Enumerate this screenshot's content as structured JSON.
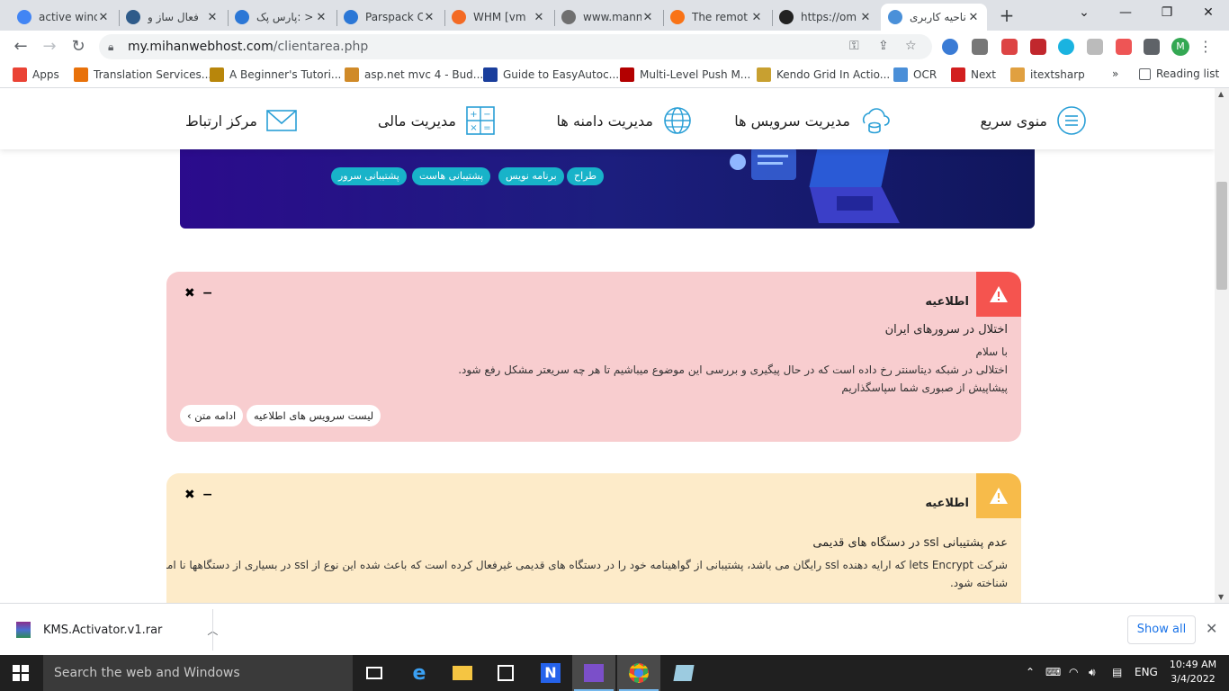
{
  "browser": {
    "tabs": [
      {
        "title": "active winc",
        "color": "#4285f4",
        "icon": "google-icon"
      },
      {
        "title": "فعال ساز و",
        "color": "#2f5b8a",
        "icon": "s-icon"
      },
      {
        "title": "پارس پک: >",
        "color": "#2b77d6",
        "icon": "parspack-icon"
      },
      {
        "title": "Parspack C",
        "color": "#2b77d6",
        "icon": "parspack-icon"
      },
      {
        "title": "WHM [vm",
        "color": "#f36a24",
        "icon": "cpanel-icon"
      },
      {
        "title": "www.mann",
        "color": "#6f6f6f",
        "icon": "globe-icon"
      },
      {
        "title": "The remot",
        "color": "#f97316",
        "icon": "mi-icon"
      },
      {
        "title": "https://om",
        "color": "#222222",
        "icon": "om-icon"
      },
      {
        "title": "ناحیه کاربری",
        "color": "#4a90d9",
        "icon": "site-icon"
      }
    ],
    "url_domain": "my.mihanwebhost.com",
    "url_path": "/clientarea.php",
    "profile_initial": "M",
    "bookmarks": [
      {
        "label": "Apps",
        "color": "#ea4335"
      },
      {
        "label": "Translation Services...",
        "color": "#e8710a"
      },
      {
        "label": "A Beginner's Tutori...",
        "color": "#b8860b"
      },
      {
        "label": "asp.net mvc 4 - Bud...",
        "color": "#d08a28"
      },
      {
        "label": "Guide to EasyAutoc...",
        "color": "#1a3e9c"
      },
      {
        "label": "Multi-Level Push M...",
        "color": "#b30000"
      },
      {
        "label": "Kendo Grid In Actio...",
        "color": "#c8a030"
      },
      {
        "label": "OCR",
        "color": "#4a8fd8"
      },
      {
        "label": "Next",
        "color": "#d21f1f"
      },
      {
        "label": "itextsharp",
        "color": "#e0a040"
      }
    ],
    "bookmarks_more": "»",
    "reading_list": "Reading list"
  },
  "site": {
    "nav": {
      "quick_menu": "منوی سریع",
      "services": "مدیریت سرویس ها",
      "domains": "مدیریت دامنه ها",
      "billing": "مدیریت مالی",
      "contact": "مرکز ارتباط"
    },
    "banner_tags": [
      "طراح",
      "برنامه نویس",
      "پشتیبانی هاست",
      "پشتیبانی سرور"
    ],
    "alerts": [
      {
        "heading": "اطلاعیه",
        "title": "اختلال در سرورهای ایران",
        "lines": [
          "با سلام",
          "اختلالی در شبکه دیتاسنتر رخ داده است که در حال پیگیری و بررسی این موضوع میباشیم تا هر چه سریعتر مشکل رفع شود.",
          "پیشاپیش از صبوری شما سپاسگذاریم"
        ],
        "btn_list": "لیست سرویس های اطلاعیه",
        "btn_more": "ادامه متن",
        "color": "#f8cdcf",
        "badge_color": "#f5544f"
      },
      {
        "heading": "اطلاعیه",
        "title": "عدم پشتیبانی ssl در دستگاه های قدیمی",
        "lines": [
          "شرکت lets Encrypt که ارایه دهنده ssl رایگان می باشد، پشتیبانی از گواهینامه خود را در دستگاه های قدیمی غیرفعال کرده است که باعث شده این نوع از ssl در بسیاری از دستگاهها نا امن",
          "شناخته شود."
        ],
        "color": "#fdebc9",
        "badge_color": "#f7bb4a"
      }
    ]
  },
  "download": {
    "filename": "KMS.Activator.v1.rar",
    "show_all": "Show all"
  },
  "taskbar": {
    "search_placeholder": "Search the web and Windows",
    "lang": "ENG",
    "time": "10:49 AM",
    "date": "3/4/2022"
  }
}
